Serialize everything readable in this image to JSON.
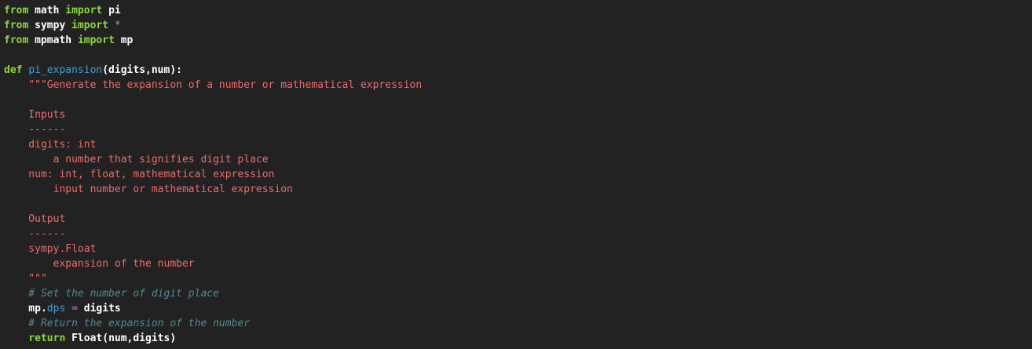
{
  "editor": {
    "colors": {
      "background": "#222222",
      "keyword": "#8bd83a",
      "name": "#ffffff",
      "operator": "#c678f0",
      "function": "#3ea0d8",
      "string": "#ee6b6b",
      "comment": "#4e8c93"
    },
    "lines": [
      [
        {
          "t": "kw",
          "v": "from"
        },
        {
          "t": "plain",
          "v": " math "
        },
        {
          "t": "kw",
          "v": "import"
        },
        {
          "t": "plain",
          "v": " pi"
        }
      ],
      [
        {
          "t": "kw",
          "v": "from"
        },
        {
          "t": "plain",
          "v": " sympy "
        },
        {
          "t": "kw",
          "v": "import"
        },
        {
          "t": "plain",
          "v": " "
        },
        {
          "t": "op",
          "v": "*"
        }
      ],
      [
        {
          "t": "kw",
          "v": "from"
        },
        {
          "t": "plain",
          "v": " mpmath "
        },
        {
          "t": "kw",
          "v": "import"
        },
        {
          "t": "plain",
          "v": " mp"
        }
      ],
      [],
      [
        {
          "t": "kw",
          "v": "def"
        },
        {
          "t": "plain",
          "v": " "
        },
        {
          "t": "fn",
          "v": "pi_expansion"
        },
        {
          "t": "plain",
          "v": "(digits,num):"
        }
      ],
      [
        {
          "t": "str",
          "v": "    \"\"\"Generate the expansion of a number or mathematical expression"
        }
      ],
      [],
      [
        {
          "t": "str",
          "v": "    Inputs"
        }
      ],
      [
        {
          "t": "str",
          "v": "    ------"
        }
      ],
      [
        {
          "t": "str",
          "v": "    digits: int"
        }
      ],
      [
        {
          "t": "str",
          "v": "        a number that signifies digit place"
        }
      ],
      [
        {
          "t": "str",
          "v": "    num: int, float, mathematical expression"
        }
      ],
      [
        {
          "t": "str",
          "v": "        input number or mathematical expression"
        }
      ],
      [],
      [
        {
          "t": "str",
          "v": "    Output"
        }
      ],
      [
        {
          "t": "str",
          "v": "    ------"
        }
      ],
      [
        {
          "t": "str",
          "v": "    sympy.Float"
        }
      ],
      [
        {
          "t": "str",
          "v": "        expansion of the number"
        }
      ],
      [
        {
          "t": "str",
          "v": "    \"\"\""
        }
      ],
      [
        {
          "t": "cm",
          "v": "    # Set the number of digit place"
        }
      ],
      [
        {
          "t": "plain",
          "v": "    mp."
        },
        {
          "t": "attr",
          "v": "dps"
        },
        {
          "t": "plain",
          "v": " "
        },
        {
          "t": "op",
          "v": "="
        },
        {
          "t": "plain",
          "v": " digits"
        }
      ],
      [
        {
          "t": "cm",
          "v": "    # Return the expansion of the number"
        }
      ],
      [
        {
          "t": "plain",
          "v": "    "
        },
        {
          "t": "kw",
          "v": "return"
        },
        {
          "t": "plain",
          "v": " Float(num,digits)"
        }
      ]
    ]
  }
}
